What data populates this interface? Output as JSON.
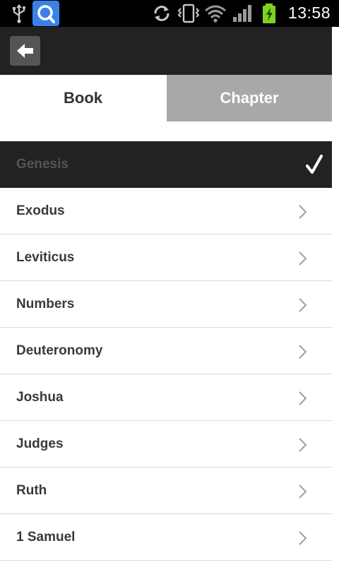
{
  "status_bar": {
    "time": "13:58",
    "icons": [
      "usb-icon",
      "search-app-icon",
      "sync-icon",
      "vibrate-icon",
      "wifi-icon",
      "signal-icon",
      "battery-charging-icon"
    ]
  },
  "action_bar": {
    "back_icon": "back-arrow-icon"
  },
  "tabs": [
    {
      "label": "Book",
      "active": true
    },
    {
      "label": "Chapter",
      "active": false
    }
  ],
  "books": [
    {
      "name": "Genesis",
      "selected": true
    },
    {
      "name": "Exodus",
      "selected": false
    },
    {
      "name": "Leviticus",
      "selected": false
    },
    {
      "name": "Numbers",
      "selected": false
    },
    {
      "name": "Deuteronomy",
      "selected": false
    },
    {
      "name": "Joshua",
      "selected": false
    },
    {
      "name": "Judges",
      "selected": false
    },
    {
      "name": "Ruth",
      "selected": false
    },
    {
      "name": "1 Samuel",
      "selected": false
    }
  ],
  "colors": {
    "status_bar_bg": "#000000",
    "action_bar_bg": "#222222",
    "active_tab_bg": "#ffffff",
    "inactive_tab_bg": "#a8a8a8",
    "selected_row_bg": "#222222",
    "app_icon_blue": "#3b82e8",
    "battery_green": "#7ed321"
  }
}
